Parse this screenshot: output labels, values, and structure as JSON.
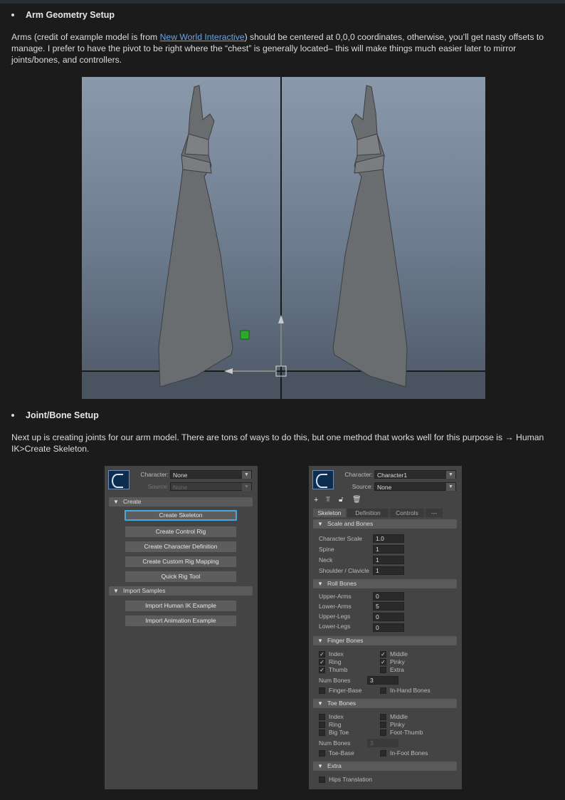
{
  "section1": {
    "heading": "Arm Geometry Setup",
    "text_before_link": "Arms (credit of example model is from ",
    "link_text": "New World Interactive",
    "text_after_link": ") should be centered at 0,0,0 coordinates, otherwise, you’ll get nasty offsets to manage. I prefer to have the pivot to be right where the “chest” is generally located– this will make things much easier later to mirror joints/bones, and controllers."
  },
  "section2": {
    "heading": "Joint/Bone Setup",
    "text": "Next up is creating joints for our arm model. There are tons of ways to do this, but one method that works well for this purpose is → Human IK>Create Skeleton."
  },
  "left_panel": {
    "character_label": "Character:",
    "character_value": "None",
    "source_label": "Source:",
    "source_value": "None",
    "create_section": "Create",
    "create_buttons": [
      "Create Skeleton",
      "Create Control Rig",
      "Create Character Definition",
      "Create Custom Rig Mapping",
      "Quick Rig Tool"
    ],
    "import_section": "Import Samples",
    "import_buttons": [
      "Import Human IK Example",
      "Import Animation Example"
    ]
  },
  "right_panel": {
    "character_label": "Character:",
    "character_value": "Character1",
    "source_label": "Source:",
    "source_value": "None",
    "tabs": [
      "Skeleton",
      "Definition",
      "Controls",
      "---"
    ],
    "scale_section": "Scale and Bones",
    "scale_rows": [
      {
        "label": "Character Scale",
        "value": "1.0"
      },
      {
        "label": "Spine",
        "value": "1"
      },
      {
        "label": "Neck",
        "value": "1"
      },
      {
        "label": "Shoulder / Clavicle",
        "value": "1"
      }
    ],
    "roll_section": "Roll Bones",
    "roll_rows": [
      {
        "label": "Upper-Arms",
        "value": "0"
      },
      {
        "label": "Lower-Arms",
        "value": "5"
      },
      {
        "label": "Upper-Legs",
        "value": "0"
      },
      {
        "label": "Lower-Legs",
        "value": "0"
      }
    ],
    "finger_section": "Finger Bones",
    "finger_left": [
      {
        "label": "Index",
        "checked": true
      },
      {
        "label": "Ring",
        "checked": true
      },
      {
        "label": "Thumb",
        "checked": true
      }
    ],
    "finger_right": [
      {
        "label": "Middle",
        "checked": true
      },
      {
        "label": "Pinky",
        "checked": true
      },
      {
        "label": "Extra",
        "checked": false
      }
    ],
    "finger_num_label": "Num Bones",
    "finger_num_value": "3",
    "finger_base_label": "Finger-Base",
    "in_hand_label": "In-Hand Bones",
    "toe_section": "Toe Bones",
    "toe_left": [
      {
        "label": "Index",
        "checked": false
      },
      {
        "label": "Ring",
        "checked": false
      },
      {
        "label": "Big Toe",
        "checked": false
      }
    ],
    "toe_right": [
      {
        "label": "Middle",
        "checked": false
      },
      {
        "label": "Pinky",
        "checked": false
      },
      {
        "label": "Foot-Thumb",
        "checked": false
      }
    ],
    "toe_num_label": "Num Bones",
    "toe_num_value": "3",
    "toe_base_label": "Toe-Base",
    "in_foot_label": "In-Foot Bones",
    "extra_section": "Extra",
    "hips_label": "Hips Translation"
  },
  "colors": {
    "link": "#6aa4e6",
    "selected_button_border": "#4aa7de",
    "manipulator_green": "#2ea82e"
  }
}
